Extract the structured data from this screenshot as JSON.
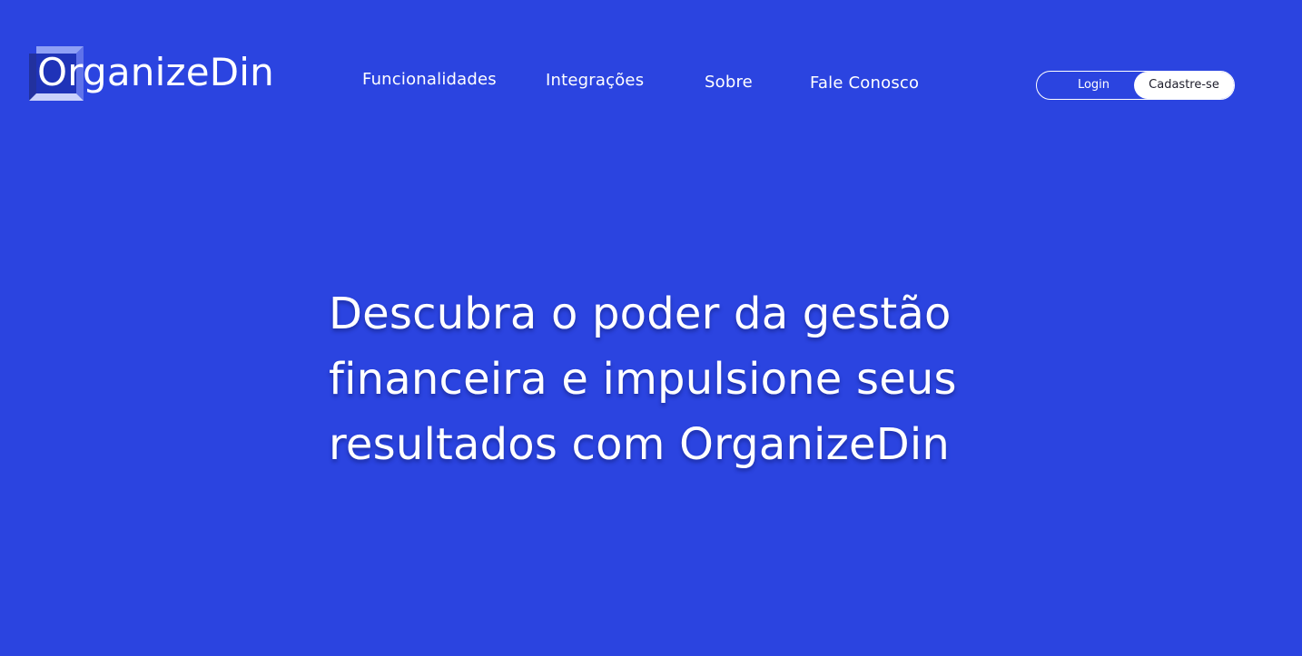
{
  "brand": {
    "name": "OrganizeDin"
  },
  "nav": {
    "items": [
      {
        "label": "Funcionalidades"
      },
      {
        "label": "Integrações"
      },
      {
        "label": "Sobre"
      },
      {
        "label": "Fale Conosco"
      }
    ]
  },
  "auth": {
    "login_label": "Login",
    "signup_label": "Cadastre-se"
  },
  "hero": {
    "lines": [
      "Descubra o poder da gestão",
      "financeira e impulsione seus",
      "resultados com OrganizeDin"
    ]
  },
  "colors": {
    "background": "#2b44e0",
    "text": "#ffffff",
    "logo_mark_dark": "#1e2fb0",
    "logo_mark_light": "#6e7ff0",
    "button_text_dark": "#1d1d2b"
  },
  "icons": {
    "logo": "cube-logo-icon"
  }
}
